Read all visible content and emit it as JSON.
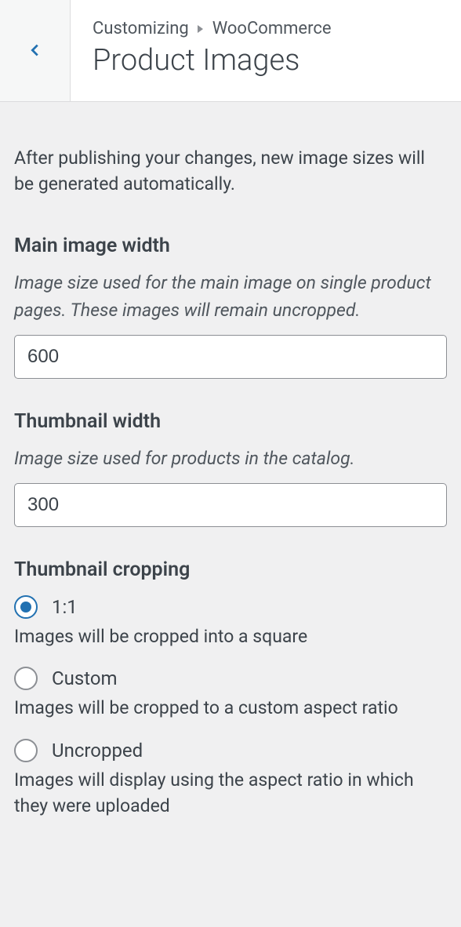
{
  "header": {
    "breadcrumb_prefix": "Customizing",
    "breadcrumb_section": "WooCommerce",
    "panel_title": "Product Images"
  },
  "info_text": "After publishing your changes, new image sizes will be generated automatically.",
  "main_image_width": {
    "label": "Main image width",
    "description": "Image size used for the main image on single product pages. These images will remain uncropped.",
    "value": "600"
  },
  "thumbnail_width": {
    "label": "Thumbnail width",
    "description": "Image size used for products in the catalog.",
    "value": "300"
  },
  "thumbnail_cropping": {
    "label": "Thumbnail cropping",
    "selected": "1_1",
    "options": [
      {
        "id": "1_1",
        "label": "1:1",
        "description": "Images will be cropped into a square"
      },
      {
        "id": "custom",
        "label": "Custom",
        "description": "Images will be cropped to a custom aspect ratio"
      },
      {
        "id": "uncropped",
        "label": "Uncropped",
        "description": "Images will display using the aspect ratio in which they were uploaded"
      }
    ]
  }
}
